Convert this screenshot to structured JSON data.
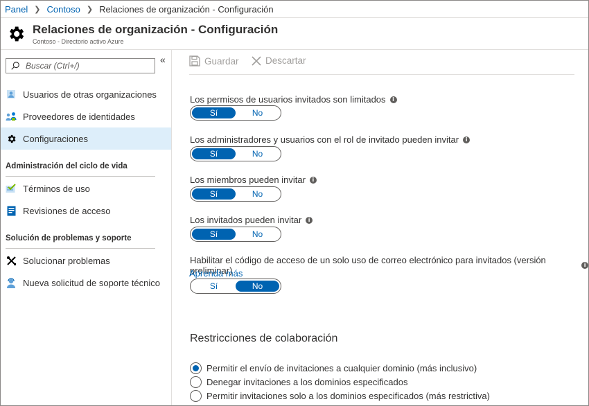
{
  "breadcrumb": {
    "items": [
      "Panel",
      "Contoso"
    ],
    "current": "Relaciones de organización - Configuración"
  },
  "header": {
    "title": "Relaciones de organización - Configuración",
    "subtitle": "Contoso - Directorio activo Azure",
    "icon": "gear-icon"
  },
  "sidebar": {
    "collapse_glyph": "«",
    "search_placeholder": "Buscar (Ctrl+/)",
    "items": [
      {
        "label": "Usuarios de otras organizaciones",
        "icon": "user-icon"
      },
      {
        "label": "Proveedores de identidades",
        "icon": "identity-providers-icon"
      },
      {
        "label": "Configuraciones",
        "icon": "gear-icon",
        "selected": true
      }
    ],
    "sections": [
      {
        "title": "Administración del ciclo de vida",
        "items": [
          {
            "label": "Términos de uso",
            "icon": "terms-checklist-icon"
          },
          {
            "label": "Revisiones de acceso",
            "icon": "access-review-icon"
          }
        ]
      },
      {
        "title": "Solución de problemas y soporte",
        "items": [
          {
            "label": "Solucionar problemas",
            "icon": "tools-icon"
          },
          {
            "label": "Nueva solicitud de soporte técnico",
            "icon": "support-icon"
          }
        ]
      }
    ]
  },
  "toolbar": {
    "save_label": "Guardar",
    "discard_label": "Descartar"
  },
  "settings": [
    {
      "label": "Los permisos de usuarios invitados son limitados",
      "info": true,
      "options": [
        "Sí",
        "No"
      ],
      "selected": "Sí"
    },
    {
      "label": "Los administradores y usuarios con el rol de invitado pueden invitar",
      "info": true,
      "options": [
        "Sí",
        "No"
      ],
      "selected": "Sí"
    },
    {
      "label": "Los miembros pueden invitar",
      "info": true,
      "options": [
        "Sí",
        "No"
      ],
      "selected": "Sí"
    },
    {
      "label": "Los invitados pueden invitar",
      "info": true,
      "options": [
        "Sí",
        "No"
      ],
      "selected": "Sí"
    },
    {
      "label": "Habilitar el código de acceso de un solo uso de correo electrónico para invitados (versión preliminar)",
      "info": true,
      "link": "Aprenda más",
      "options": [
        "Sí",
        "No"
      ],
      "selected": "No"
    }
  ],
  "collaboration": {
    "title": "Restricciones de colaboración",
    "options": [
      {
        "label": "Permitir el envío de invitaciones a cualquier dominio (más inclusivo)",
        "checked": true
      },
      {
        "label": "Denegar invitaciones a los dominios especificados",
        "checked": false
      },
      {
        "label": "Permitir invitaciones solo a los dominios especificados (más restrictiva)",
        "checked": false
      }
    ]
  },
  "colors": {
    "accent": "#0063b1",
    "selected_nav": "#ddeefa",
    "disabled": "#a19f9d"
  }
}
